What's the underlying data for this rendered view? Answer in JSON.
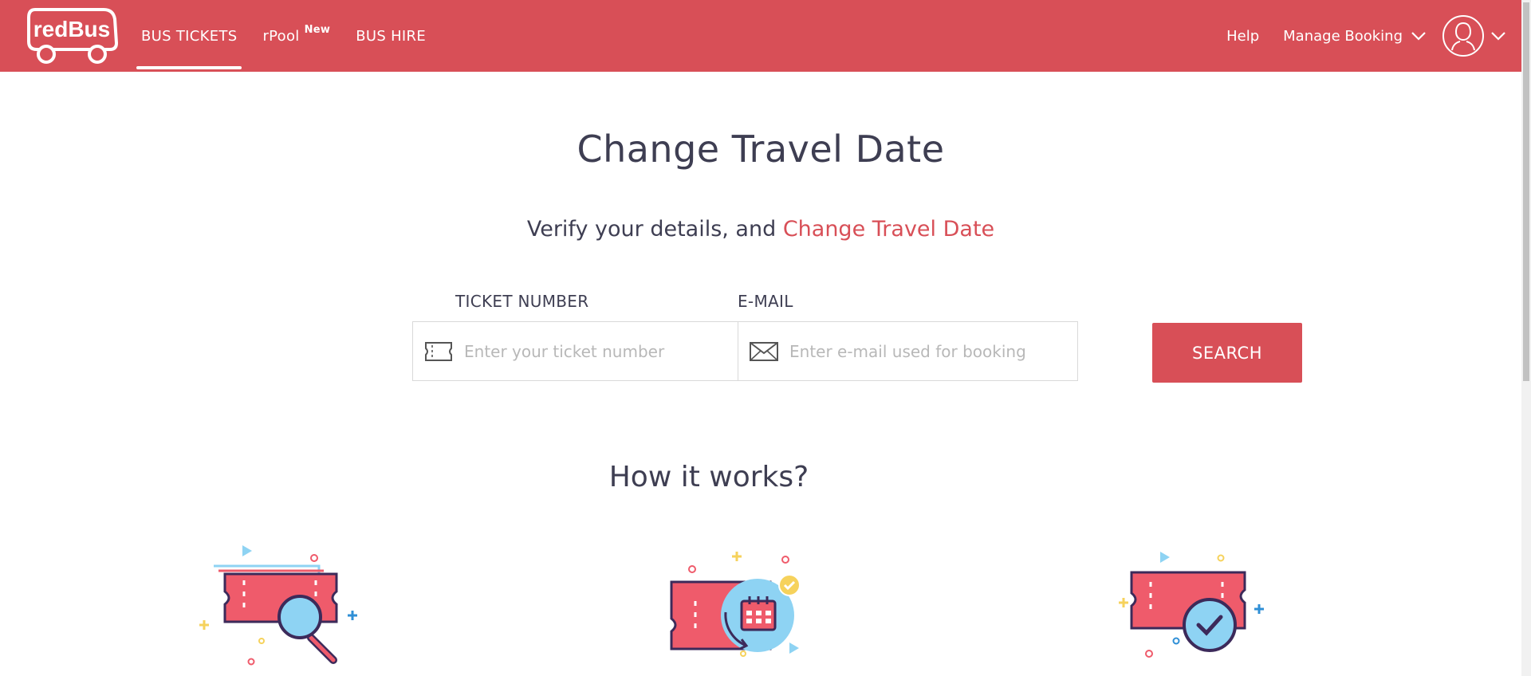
{
  "header": {
    "logo_text": "redBus",
    "nav": [
      {
        "label": "BUS TICKETS",
        "active": true
      },
      {
        "label": "rPool",
        "badge": "New",
        "active": false
      },
      {
        "label": "BUS HIRE",
        "active": false
      }
    ],
    "right": {
      "help": "Help",
      "manage_booking": "Manage Booking"
    },
    "icons": {
      "account": "user-account-icon",
      "dropdown": "chevron-down-icon"
    }
  },
  "main": {
    "title": "Change Travel Date",
    "subtitle_prefix": "Verify your details, and ",
    "subtitle_accent": "Change Travel Date",
    "form": {
      "ticket_label": "TICKET NUMBER",
      "ticket_placeholder": "Enter your ticket number",
      "ticket_value": "",
      "email_label": "E-MAIL",
      "email_placeholder": "Enter e-mail used for booking",
      "email_value": "",
      "search_label": "SEARCH"
    },
    "how_title": "How it works?"
  },
  "colors": {
    "brand": "#d84f57",
    "text": "#3e3e52",
    "placeholder": "#b8b8b8",
    "illus_blue": "#8ed3f3",
    "illus_pink": "#ef5b6b",
    "illus_navy": "#3c2a5a",
    "illus_yellow": "#f6d25c"
  }
}
